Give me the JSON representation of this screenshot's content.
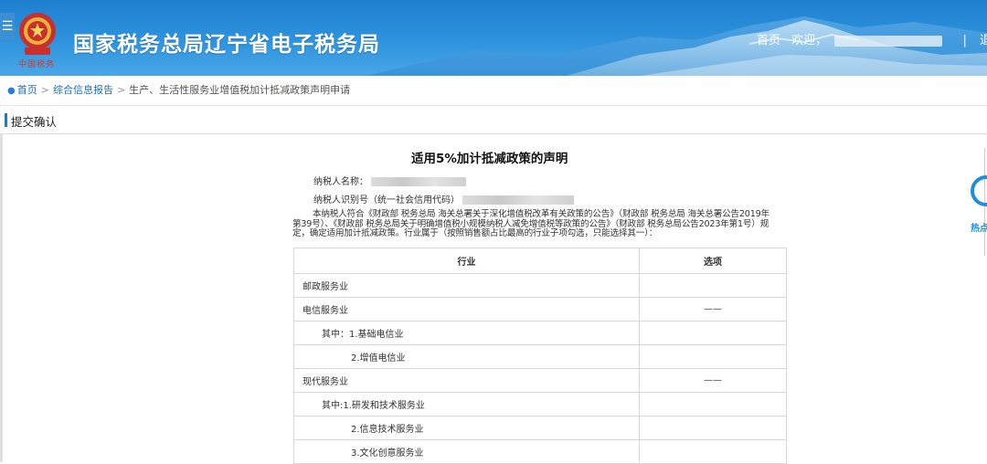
{
  "header": {
    "emblem_caption": "中国税务",
    "site_title": "国家税务总局辽宁省电子税务局",
    "nav_home": "首页",
    "nav_welcome": "欢迎，",
    "nav_sep": "|",
    "nav_logout": "退出",
    "menu_icon": "menu-icon"
  },
  "breadcrumb": {
    "home": "首页",
    "sep": ">",
    "level1": "综合信息报告",
    "level2": "生产、生活性服务业增值税加计抵减政策声明申请"
  },
  "section": {
    "title": "提交确认"
  },
  "declaration": {
    "title": "适用5%加计抵减政策的声明",
    "taxpayer_name_label": "纳税人名称：",
    "taxpayer_id_label": "纳税人识别号（统一社会信用代码）",
    "paragraph": "本纳税人符合《财政部 税务总局 海关总署关于深化增值税改革有关政策的公告》（财政部 税务总局 海关总署公告2019年第39号）、《财政部 税务总局关于明确增值税小规模纳税人减免增值税等政策的公告》（财政部 税务总局公告2023年第1号）规定，确定适用加计抵减政策。行业属于（按照销售额占比最高的行业子项勾选，只能选择其一）：",
    "table": {
      "headers": [
        "行业",
        "选项"
      ],
      "rows": [
        {
          "industry": "邮政服务业",
          "option": ""
        },
        {
          "industry": "电信服务业",
          "option": "——"
        },
        {
          "industry": "其中：1.基础电信业",
          "option": ""
        },
        {
          "industry": "2.增值电信业",
          "option": ""
        },
        {
          "industry": "现代服务业",
          "option": "——"
        },
        {
          "industry": "其中:1.研发和技术服务业",
          "option": ""
        },
        {
          "industry": "2.信息技术服务业",
          "option": ""
        },
        {
          "industry": "3.文化创意服务业",
          "option": ""
        }
      ]
    }
  },
  "hotspot": {
    "label": "热点",
    "icon": "hotspot-icon"
  }
}
